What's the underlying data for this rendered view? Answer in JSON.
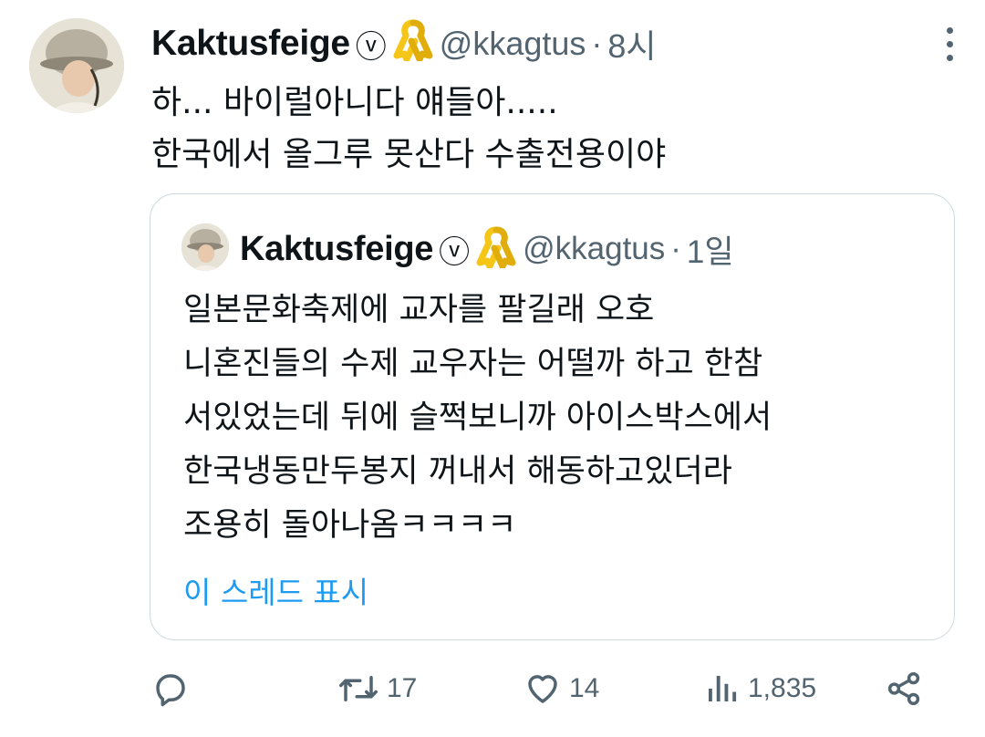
{
  "tweet": {
    "display_name": "Kaktusfeige",
    "verified_glyph": "ⓥ",
    "badge_icon": "yellow-ribbon-icon",
    "handle": "@kkagtus",
    "separator": "·",
    "time": "8시",
    "text_lines": [
      "하... 바이럴아니다 얘들아.....",
      "한국에서 올그루 못산다 수출전용이야"
    ]
  },
  "quote": {
    "display_name": "Kaktusfeige",
    "verified_glyph": "ⓥ",
    "badge_icon": "yellow-ribbon-icon",
    "handle": "@kkagtus",
    "separator": "·",
    "time": "1일",
    "text_lines": [
      "일본문화축제에 교자를 팔길래 오호",
      "니혼진들의 수제 교우자는 어떨까 하고 한참",
      "서있었는데 뒤에 슬쩍보니까 아이스박스에서",
      "한국냉동만두봉지 꺼내서 해동하고있더라",
      "조용히 돌아나옴ㅋㅋㅋㅋ"
    ],
    "show_thread": "이 스레드 표시"
  },
  "actions": {
    "reply_icon": "reply-icon",
    "retweet_icon": "retweet-icon",
    "retweet_count": "17",
    "like_icon": "heart-icon",
    "like_count": "14",
    "views_icon": "views-icon",
    "views_count": "1,835",
    "share_icon": "share-icon"
  },
  "colors": {
    "text": "#0f1419",
    "secondary": "#536471",
    "link": "#1d9bf0",
    "border": "#cfd9de",
    "ribbon": "#f5c518"
  }
}
